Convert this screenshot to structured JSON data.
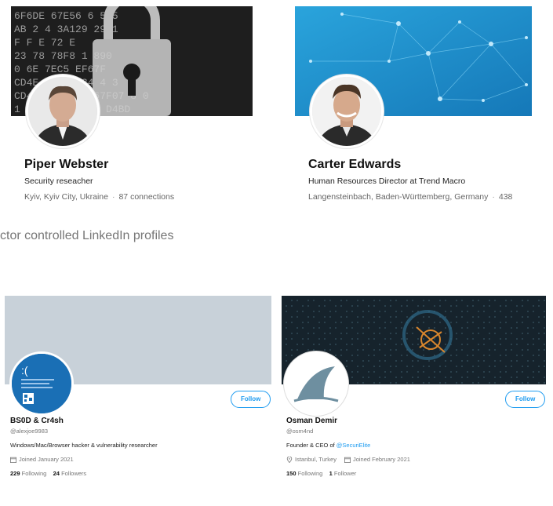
{
  "linkedin": [
    {
      "name": "Piper Webster",
      "headline": "Security reseacher",
      "location": "Kyiv, Kyiv City, Ukraine",
      "connections": "87 connections",
      "banner": "security-lock-banner",
      "banner_hex_rows": [
        "6F6DE  67E56  6  5  5",
        "AB  2  4 3A129 2901",
        "F  F  E  72  E",
        "23  78 78F8  1 890",
        "0  6E 7EC5  EF67F",
        "CD4E 3 2B 834 4 3",
        "CD4  ABC 4  6B 67F07 8 0",
        "1  A 2  49 2C 2A D4BD"
      ]
    },
    {
      "name": "Carter Edwards",
      "headline": "Human Resources Director at Trend Macro",
      "location": "Langensteinbach, Baden-Württemberg, Germany",
      "connections": "438",
      "banner": "network-banner"
    }
  ],
  "caption": "ctor controlled LinkedIn profiles",
  "twitter": [
    {
      "name": "BS0D & Cr4sh",
      "handle": "@alexjoe9983",
      "bio": "Windows/Mac/Browser hacker & vulnerability researcher",
      "joined": "Joined January 2021",
      "following_count": "229",
      "following_label": "Following",
      "followers_count": "24",
      "followers_label": "Followers",
      "follow_label": "Follow",
      "avatar_text": ":("
    },
    {
      "name": "Osman Demir",
      "handle": "@osm4nd",
      "bio_prefix": "Founder & CEO of ",
      "bio_link": "@SecuriElite",
      "location": "Istanbul, Turkey",
      "joined": "Joined February 2021",
      "following_count": "150",
      "following_label": "Following",
      "followers_count": "1",
      "followers_label": "Follower",
      "follow_label": "Follow"
    }
  ],
  "colors": {
    "twitter_blue": "#1d9bf0",
    "bsod_blue": "#1a6fb5",
    "network_blue": "#1e94d0",
    "banner_grey": "#c8d1d9"
  }
}
